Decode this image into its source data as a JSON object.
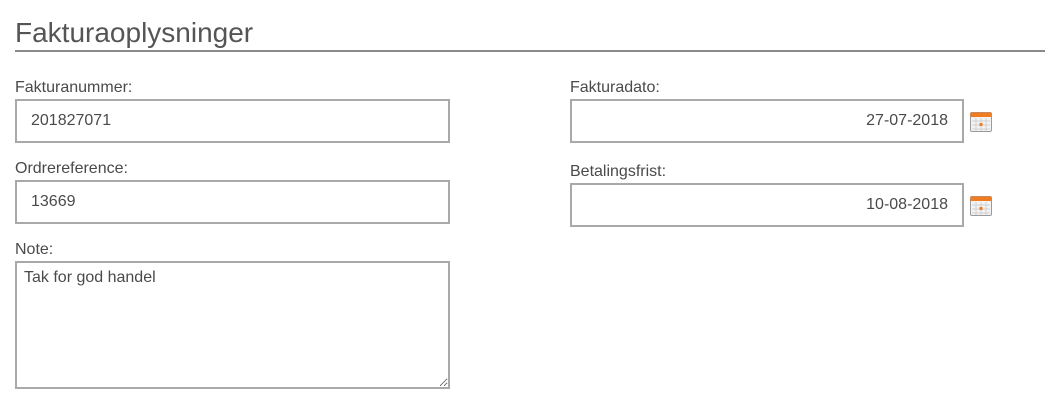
{
  "section": {
    "title": "Fakturaoplysninger"
  },
  "fields": {
    "invoice_number": {
      "label": "Fakturanummer:",
      "value": "201827071"
    },
    "order_reference": {
      "label": "Ordrereference:",
      "value": "13669"
    },
    "note": {
      "label": "Note:",
      "value": "Tak for god handel"
    },
    "invoice_date": {
      "label": "Fakturadato:",
      "value": "27-07-2018"
    },
    "due_date": {
      "label": "Betalingsfrist:",
      "value": "10-08-2018"
    }
  },
  "icons": {
    "calendar": "calendar-icon"
  },
  "colors": {
    "calendar_accent": "#f07c22",
    "border": "#a9a9a9",
    "rule": "#8a8a8a"
  }
}
